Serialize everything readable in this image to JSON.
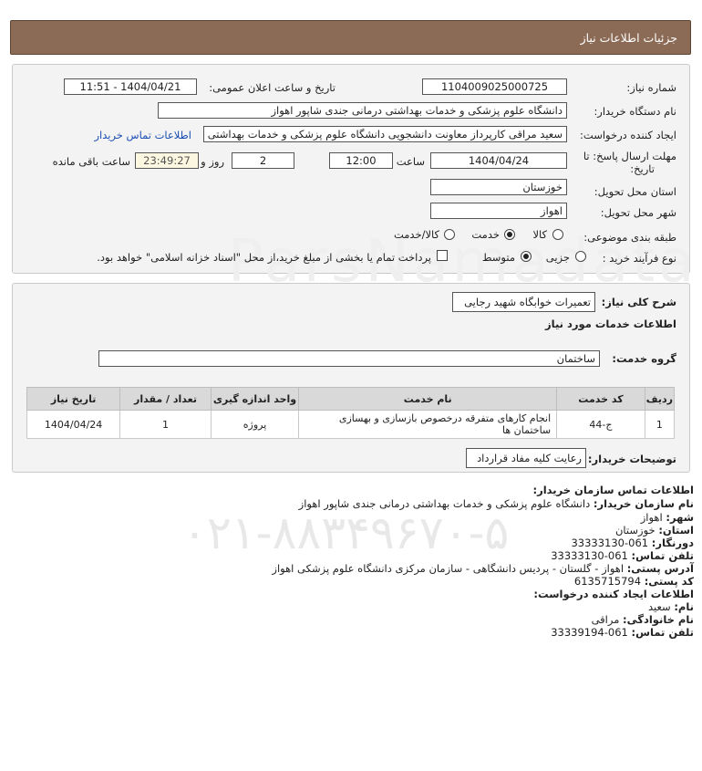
{
  "header": {
    "title": "جزئیات اطلاعات نیاز"
  },
  "form": {
    "need_number_label": "شماره نیاز:",
    "need_number": "1104009025000725",
    "announce_label": "تاریخ و ساعت اعلان عمومی:",
    "announce_value": "1404/04/21 - 11:51",
    "buyer_org_label": "نام دستگاه خریدار:",
    "buyer_org": "دانشگاه علوم پزشکی و خدمات بهداشتی درمانی جندی شاپور اهواز",
    "creator_label": "ایجاد کننده درخواست:",
    "creator": "سعید مراقی کارپرداز معاونت دانشجویی دانشگاه علوم پزشکی و خدمات بهداشتی",
    "contact_link": "اطلاعات تماس خریدار",
    "deadline_label_1": "مهلت ارسال پاسخ: تا",
    "deadline_label_2": "تاریخ:",
    "deadline_date": "1404/04/24",
    "time_label": "ساعت",
    "deadline_time": "12:00",
    "days_value": "2",
    "days_label": "روز و",
    "remaining_time": "23:49:27",
    "remaining_label": "ساعت باقی مانده",
    "province_label": "استان محل تحویل:",
    "province": "خوزستان",
    "city_label": "شهر محل تحویل:",
    "city": "اهواز",
    "category_label": "طبقه بندی موضوعی:",
    "category_options": [
      "کالا",
      "خدمت",
      "کالا/خدمت"
    ],
    "category_selected": "خدمت",
    "process_label": "نوع فرآیند خرید :",
    "process_options": [
      "جزیی",
      "متوسط"
    ],
    "process_selected": "متوسط",
    "payment_note": "پرداخت تمام یا بخشی از مبلغ خرید،از محل \"اسناد خزانه اسلامی\" خواهد بود."
  },
  "detail": {
    "summary_label": "شرح کلی نیاز:",
    "summary": "تعمیرات خوابگاه شهید رجایی",
    "services_heading": "اطلاعات خدمات مورد نیاز",
    "service_group_label": "گروه خدمت:",
    "service_group": "ساختمان",
    "table_headers": [
      "ردیف",
      "کد خدمت",
      "نام خدمت",
      "واحد اندازه گیری",
      "تعداد / مقدار",
      "تاریخ نیاز"
    ],
    "rows": [
      {
        "idx": "1",
        "code": "ج-44",
        "name": "انجام کارهای متفرقه درخصوص بازسازی و بهسازی ساختمان ها",
        "unit": "پروژه",
        "qty": "1",
        "date": "1404/04/24"
      }
    ],
    "buyer_notes_label": "توضیحات خریدار:",
    "buyer_notes": "رعایت کلیه مفاد قرارداد"
  },
  "contact": {
    "heading": "اطلاعات تماس سازمان خریدار:",
    "org_name_label": "نام سازمان خریدار:",
    "org_name": "دانشگاه علوم پزشکی و خدمات بهداشتی درمانی جندی شاپور اهواز",
    "city_label": "شهر:",
    "city": "اهواز",
    "province_label": "استان:",
    "province": "خوزستان",
    "fax_label": "دورنگار:",
    "fax": "061-33333130",
    "phone_label": "تلفن تماس:",
    "phone": "061-33333130",
    "address_label": "آدرس پستی:",
    "address": "اهواز - گلستان - پردیس دانشگاهی - سازمان مرکزی دانشگاه علوم پزشکی اهواز",
    "postal_label": "کد پستی:",
    "postal": "6135715794",
    "creator_heading": "اطلاعات ایجاد کننده درخواست:",
    "first_name_label": "نام:",
    "first_name": "سعید",
    "last_name_label": "نام خانوادگی:",
    "last_name": "مراقی",
    "creator_phone_label": "تلفن تماس:",
    "creator_phone": "061-33339194"
  }
}
